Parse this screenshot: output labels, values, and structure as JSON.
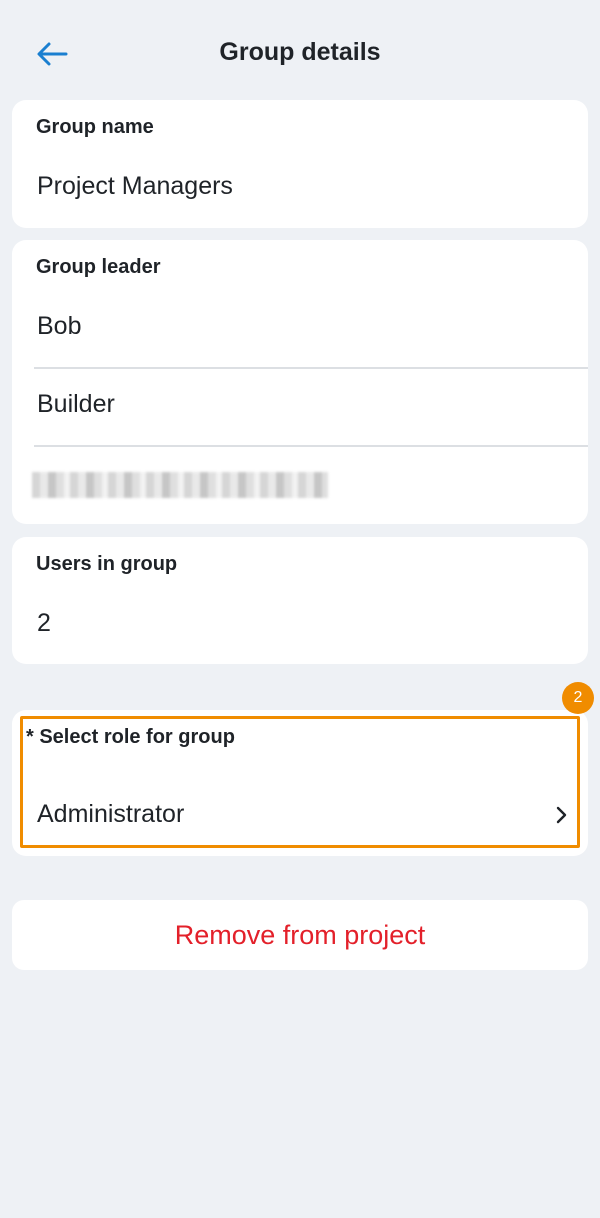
{
  "header": {
    "title": "Group details",
    "back_icon": "arrow-left-icon"
  },
  "group_name": {
    "label": "Group name",
    "value": "Project Managers"
  },
  "group_leader": {
    "label": "Group leader",
    "first_name": "Bob",
    "last_name": "Builder"
  },
  "users_in_group": {
    "label": "Users in group",
    "value": "2"
  },
  "role": {
    "label": "* Select role for group",
    "value": "Administrator",
    "badge": "2",
    "highlight_color": "#f08c00"
  },
  "actions": {
    "remove_label": "Remove from project",
    "remove_color": "#e3202a"
  },
  "colors": {
    "accent": "#1a7fd0",
    "background": "#eef1f5"
  }
}
